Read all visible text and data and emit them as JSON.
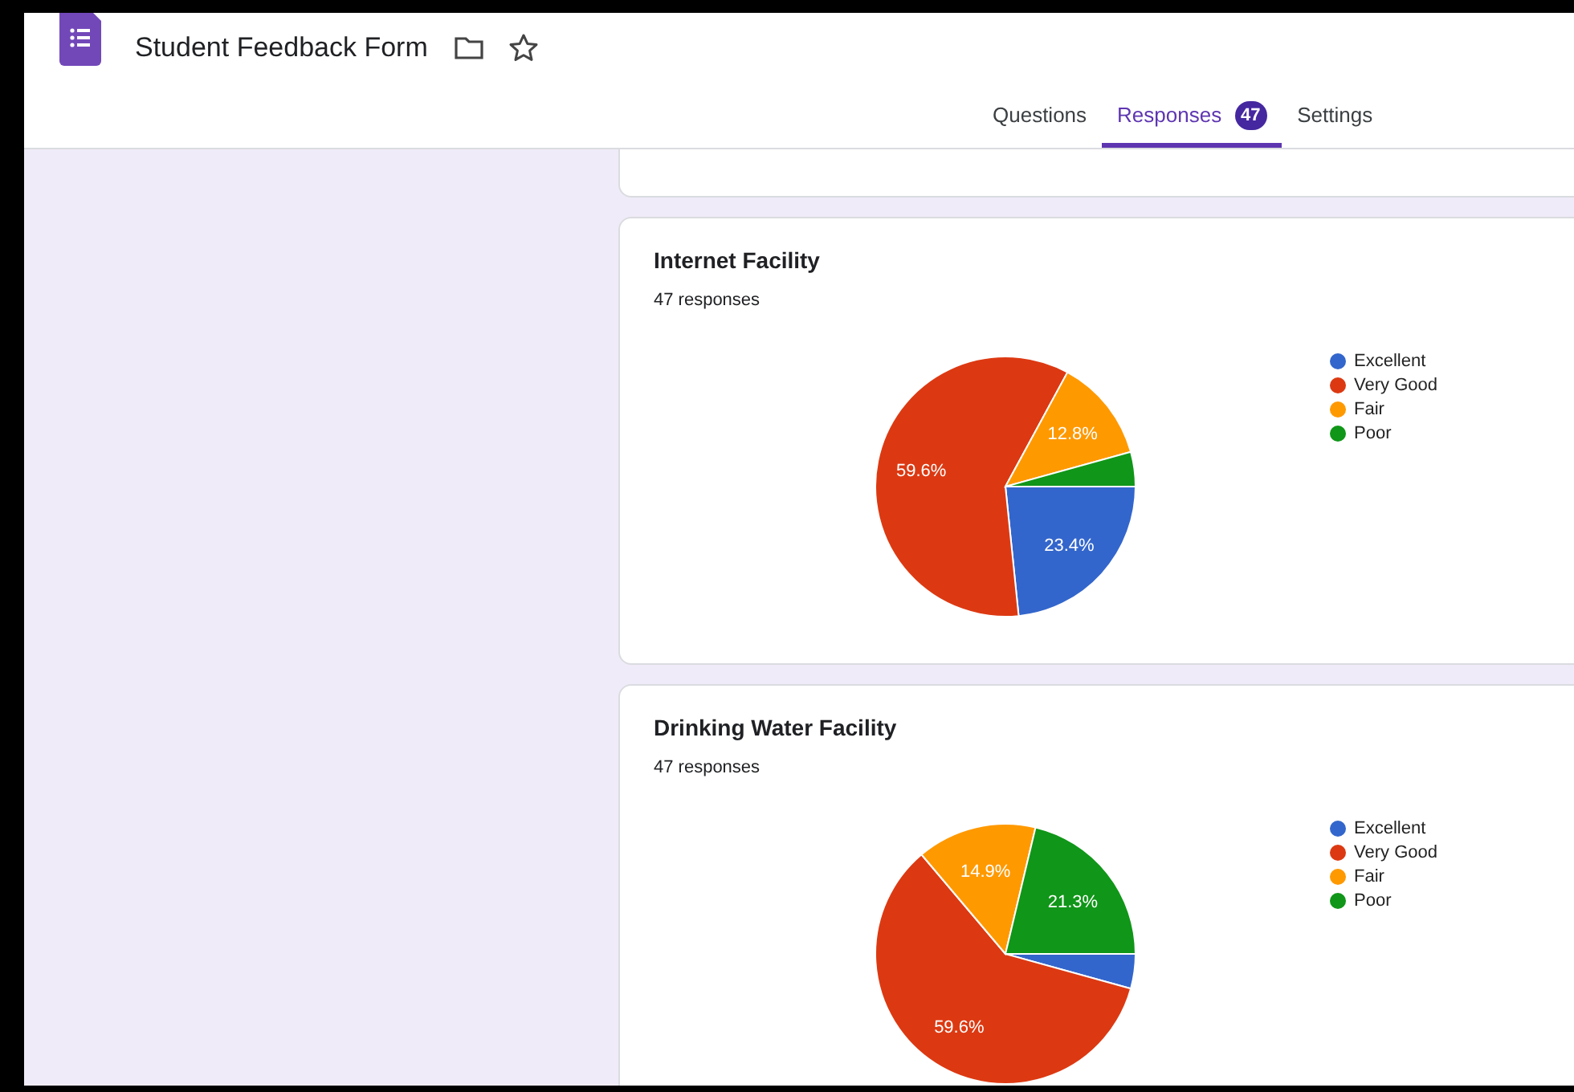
{
  "document": {
    "title": "Student Feedback Form"
  },
  "tabs": [
    {
      "label": "Questions",
      "selected": false
    },
    {
      "label": "Responses",
      "selected": true,
      "badge": "47"
    },
    {
      "label": "Settings",
      "selected": false
    }
  ],
  "questions": [
    {
      "title": "Internet Facility",
      "response_count": "47 responses",
      "chart_data": {
        "type": "pie",
        "categories": [
          "Excellent",
          "Very Good",
          "Fair",
          "Poor"
        ],
        "colors": [
          "#3366cc",
          "#dc3912",
          "#ff9900",
          "#109618"
        ],
        "series": [
          {
            "values": [
              23.4,
              59.6,
              12.8,
              4.3
            ]
          }
        ],
        "value_labels": [
          "23.4%",
          "59.6%",
          "12.8%",
          null
        ]
      }
    },
    {
      "title": "Drinking Water Facility",
      "response_count": "47 responses",
      "chart_data": {
        "type": "pie",
        "categories": [
          "Excellent",
          "Very Good",
          "Fair",
          "Poor"
        ],
        "colors": [
          "#3366cc",
          "#dc3912",
          "#ff9900",
          "#109618"
        ],
        "series": [
          {
            "values": [
              4.3,
              59.6,
              14.9,
              21.3
            ]
          }
        ],
        "value_labels": [
          null,
          "59.6%",
          "14.9%",
          "21.3%"
        ]
      }
    }
  ]
}
